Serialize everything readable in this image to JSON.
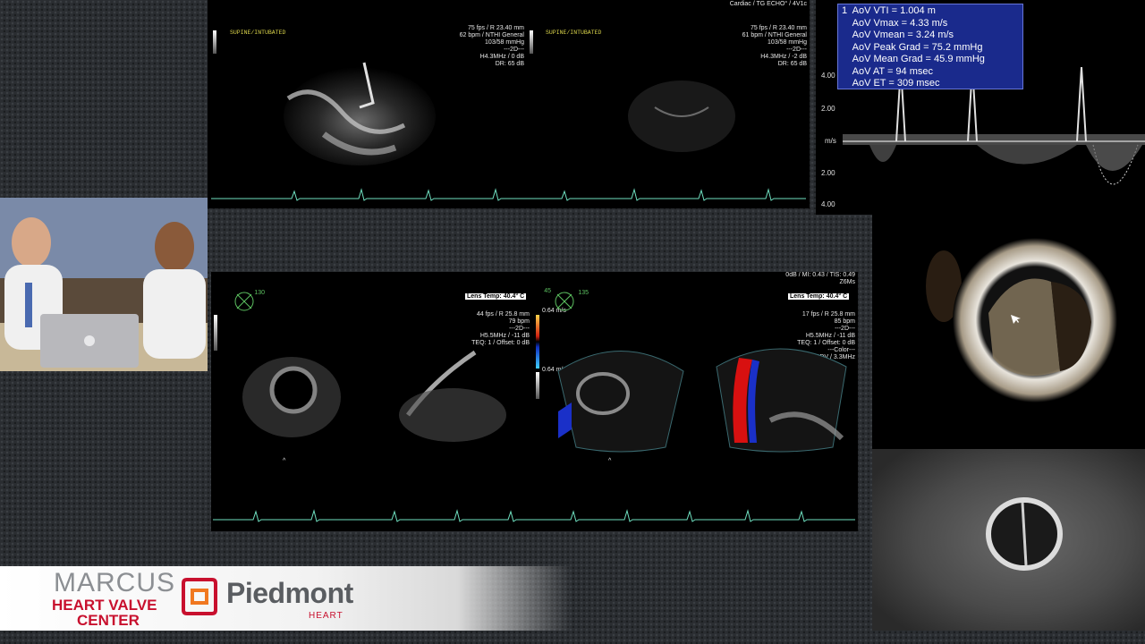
{
  "echo_top": {
    "header": "Cardiac / TG ECHO° / 4V1c",
    "left_label": "SUPINE/INTUBATED",
    "left_params": [
      "75 fps / R 23.40 mm",
      "62 bpm / NTHI General",
      "103/58 mmHg",
      "---2D---",
      "H4.3MHz / 0 dB",
      "DR: 65 dB"
    ],
    "right_label": "SUPINE/INTUBATED",
    "right_params": [
      "75 fps / R 23.40 mm",
      "61 bpm / NTHI General",
      "103/58 mmHg",
      "---2D---",
      "H4.3MHz / -2 dB",
      "DR: 65 dB"
    ]
  },
  "measurements": {
    "rows": [
      "1  AoV VTI = 1.004 m",
      "    AoV Vmax = 4.33 m/s",
      "    AoV Vmean = 3.24 m/s",
      "    AoV Peak Grad = 75.2 mmHg",
      "    AoV Mean Grad = 45.9 mmHg",
      "    AoV AT = 94 msec",
      "    AoV ET = 309 msec"
    ]
  },
  "doppler_axis": {
    "ticks": [
      "4.00",
      "2.00",
      "m/s",
      "2.00",
      "4.00"
    ]
  },
  "echo_bottom": {
    "top_right": [
      "0dB / MI: 0.43 / TIS: 0.49",
      "Z6Ms"
    ],
    "left_angle": "130",
    "left_lens": "Lens Temp: 40.4° C",
    "left_params": [
      "44 fps / R 25.8 mm",
      "79 bpm",
      "---2D---",
      "H5.5MHz / -11 dB",
      "TEQ: 1 / Offset: 0 dB"
    ],
    "color_scale_top": "0.64 m/s",
    "color_scale_bottom": "0.64 m/s",
    "right_angle_num": "45",
    "right_angle": "135",
    "right_lens": "Lens Temp: 40.4° C",
    "right_params": [
      "17 fps / R 25.8 mm",
      "85 bpm",
      "---2D---",
      "H5.5MHz / -11 dB",
      "TEQ: 1 / Offset: 0 dB",
      "---Color---",
      "CDV / 3.3MHz"
    ]
  },
  "brand": {
    "marcus": "MARCUS",
    "heart_valve": "HEART VALVE",
    "center": "CENTER",
    "piedmont": "Piedmont",
    "heart": "HEART"
  },
  "colors": {
    "brand_red": "#c8102e",
    "brand_grey": "#8c8f93",
    "measurement_box": "#1a2a8c"
  }
}
